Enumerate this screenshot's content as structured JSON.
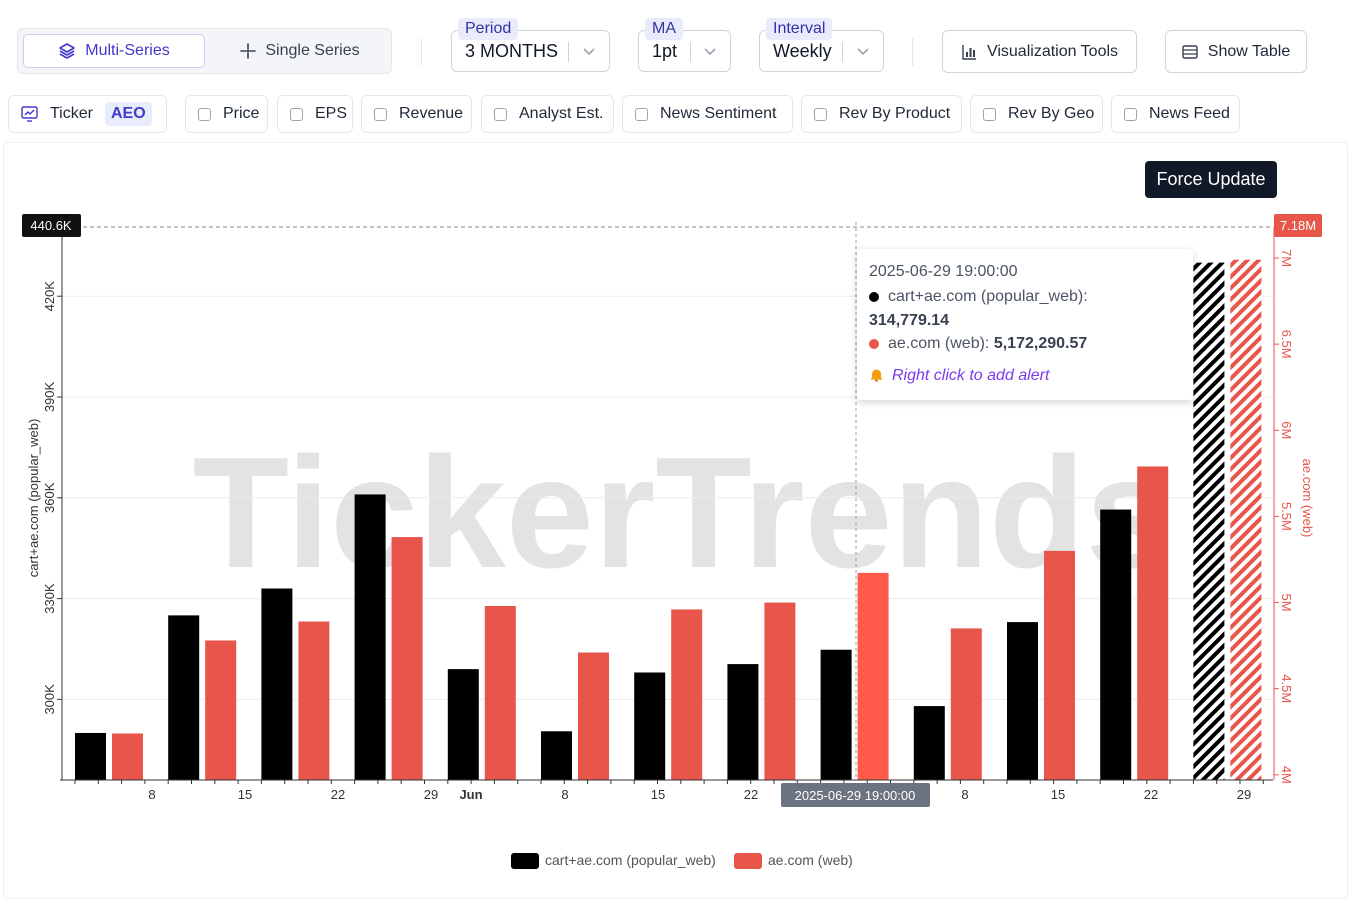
{
  "toolbar": {
    "multi_series_label": "Multi-Series",
    "single_series_label": "Single Series",
    "period": {
      "label": "Period",
      "value": "3 MONTHS"
    },
    "ma": {
      "label": "MA",
      "value": "1pt"
    },
    "interval": {
      "label": "Interval",
      "value": "Weekly"
    },
    "visualization_tools_label": "Visualization Tools",
    "show_table_label": "Show Table"
  },
  "filters": {
    "ticker_label": "Ticker",
    "ticker_value": "AEO",
    "items": [
      "Price",
      "EPS",
      "Revenue",
      "Analyst Est.",
      "News Sentiment",
      "Rev By Product",
      "Rev By Geo",
      "News Feed"
    ]
  },
  "force_update_label": "Force Update",
  "watermark": "TickerTrends",
  "tooltip": {
    "date": "2025-06-29 19:00:00",
    "series1_label": "cart+ae.com (popular_web):",
    "series1_value": "314,779.14",
    "series2_label": "ae.com (web):",
    "series2_value": "5,172,290.57",
    "alert_text": "Right click to add alert",
    "alert_icon": "bell-icon"
  },
  "colors": {
    "series1": "#000000",
    "series2": "#e8554a",
    "series2_highlight": "#ff5a4a",
    "accent": "#4338ca"
  },
  "chart_data": {
    "type": "bar",
    "x_tick_labels": [
      "8",
      "15",
      "22",
      "29",
      "Jun",
      "8",
      "15",
      "22",
      "8",
      "15",
      "22",
      "29"
    ],
    "crosshair_label": "2025-06-29 19:00:00",
    "left_axis": {
      "label": "cart+ae.com (popular_web)",
      "ticks": [
        "300K",
        "330K",
        "360K",
        "390K",
        "420K"
      ],
      "range": [
        276000,
        440600
      ],
      "max_marker": "440.6K"
    },
    "right_axis": {
      "label": "ae.com (web)",
      "ticks": [
        "4M",
        "4.5M",
        "5M",
        "5.5M",
        "6M",
        "6.5M",
        "7M"
      ],
      "range": [
        3970000,
        7180000
      ],
      "max_marker": "7.18M"
    },
    "series": [
      {
        "name": "cart+ae.com (popular_web)",
        "axis": "left",
        "values": [
          290000,
          325000,
          333000,
          361000,
          309000,
          290500,
          308000,
          310500,
          314779.14,
          298000,
          323000,
          356500,
          430000
        ],
        "projected": [
          false,
          false,
          false,
          false,
          false,
          false,
          false,
          false,
          false,
          false,
          false,
          false,
          true
        ]
      },
      {
        "name": "ae.com (web)",
        "axis": "right",
        "values": [
          4240000,
          4780000,
          4890000,
          5380000,
          4980000,
          4710000,
          4960000,
          5000000,
          5172290.57,
          4850000,
          5300000,
          5790000,
          6990000
        ],
        "projected": [
          false,
          false,
          false,
          false,
          false,
          false,
          false,
          false,
          false,
          false,
          false,
          false,
          true
        ]
      }
    ],
    "highlight_index": 8,
    "legend": [
      "cart+ae.com (popular_web)",
      "ae.com (web)"
    ],
    "legend_position": "bottom",
    "grid": true
  }
}
